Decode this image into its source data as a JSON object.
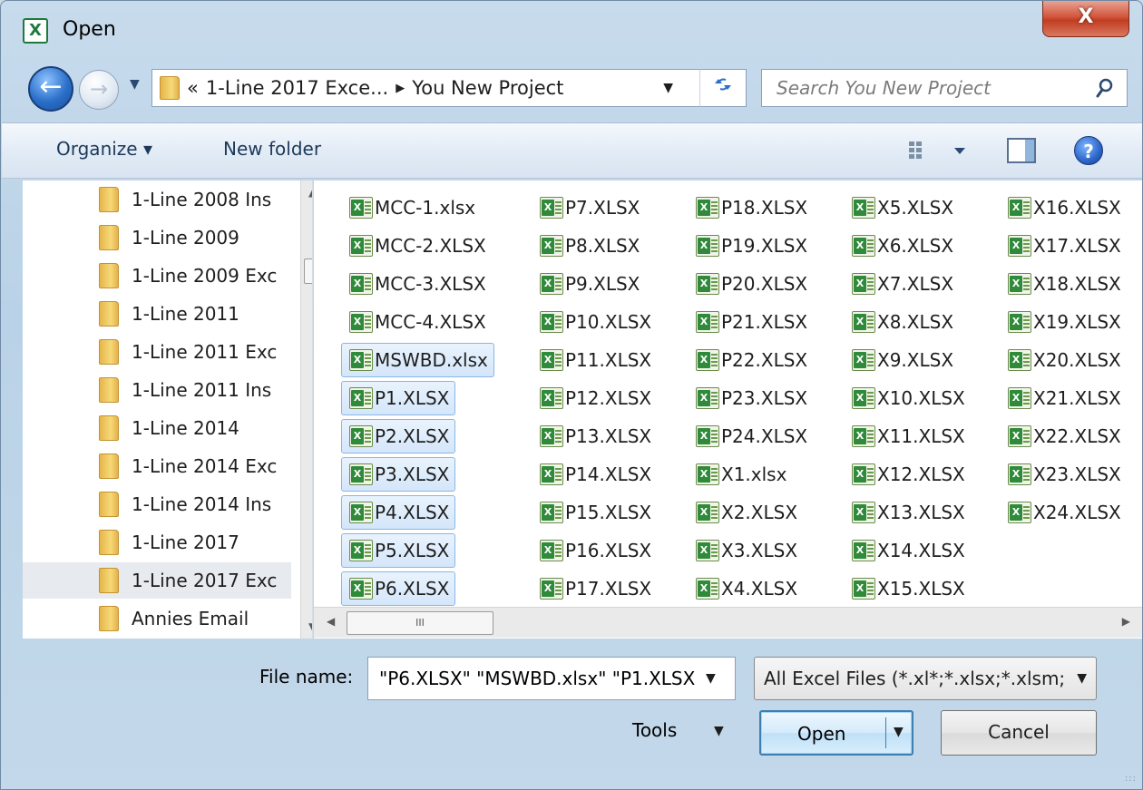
{
  "window": {
    "title": "Open",
    "close_label": "X"
  },
  "nav": {
    "back_glyph": "←",
    "forward_glyph": "→",
    "breadcrumb": {
      "overflow": "«",
      "crumbs": [
        "1-Line 2017 Exce...",
        "You New Project"
      ],
      "separator": "▶"
    },
    "search_placeholder": "Search You New Project"
  },
  "toolbar": {
    "organize_label": "Organize ▾",
    "new_folder_label": "New folder",
    "help_label": "?"
  },
  "nav_pane": {
    "items": [
      "1-Line 2008 Ins",
      "1-Line 2009",
      "1-Line 2009 Exc",
      "1-Line 2011",
      "1-Line 2011 Exc",
      "1-Line 2011 Ins",
      "1-Line 2014",
      "1-Line 2014 Exc",
      "1-Line 2014 Ins",
      "1-Line 2017",
      "1-Line 2017 Exc",
      "Annies Email"
    ],
    "selected_index": 10
  },
  "files": {
    "columns": [
      [
        "MCC-1.xlsx",
        "MCC-2.XLSX",
        "MCC-3.XLSX",
        "MCC-4.XLSX",
        "MSWBD.xlsx",
        "P1.XLSX",
        "P2.XLSX",
        "P3.XLSX",
        "P4.XLSX",
        "P5.XLSX",
        "P6.XLSX"
      ],
      [
        "P7.XLSX",
        "P8.XLSX",
        "P9.XLSX",
        "P10.XLSX",
        "P11.XLSX",
        "P12.XLSX",
        "P13.XLSX",
        "P14.XLSX",
        "P15.XLSX",
        "P16.XLSX",
        "P17.XLSX"
      ],
      [
        "P18.XLSX",
        "P19.XLSX",
        "P20.XLSX",
        "P21.XLSX",
        "P22.XLSX",
        "P23.XLSX",
        "P24.XLSX",
        "X1.xlsx",
        "X2.XLSX",
        "X3.XLSX",
        "X4.XLSX"
      ],
      [
        "X5.XLSX",
        "X6.XLSX",
        "X7.XLSX",
        "X8.XLSX",
        "X9.XLSX",
        "X10.XLSX",
        "X11.XLSX",
        "X12.XLSX",
        "X13.XLSX",
        "X14.XLSX",
        "X15.XLSX"
      ],
      [
        "X16.XLSX",
        "X17.XLSX",
        "X18.XLSX",
        "X19.XLSX",
        "X20.XLSX",
        "X21.XLSX",
        "X22.XLSX",
        "X23.XLSX",
        "X24.XLSX"
      ]
    ],
    "selected": [
      "MSWBD.xlsx",
      "P1.XLSX",
      "P2.XLSX",
      "P3.XLSX",
      "P4.XLSX",
      "P5.XLSX",
      "P6.XLSX"
    ]
  },
  "hscroll": {
    "thumb_label": "III"
  },
  "bottom": {
    "file_name_label": "File name:",
    "file_name_value": "\"P6.XLSX\" \"MSWBD.xlsx\" \"P1.XLSX",
    "file_type_value": "All Excel Files (*.xl*;*.xlsx;*.xlsm;",
    "tools_label": "Tools",
    "open_label": "Open",
    "cancel_label": "Cancel"
  },
  "colors": {
    "selection_fill": "#d4e6fa",
    "selection_border": "#8ab6e6",
    "excel_green": "#2f8a3a",
    "close_red": "#c13d22"
  },
  "icons": {
    "folder": "folder-icon",
    "excel_file": "excel-file-icon",
    "search": "search-icon",
    "refresh": "refresh-icon",
    "help": "help-icon"
  }
}
